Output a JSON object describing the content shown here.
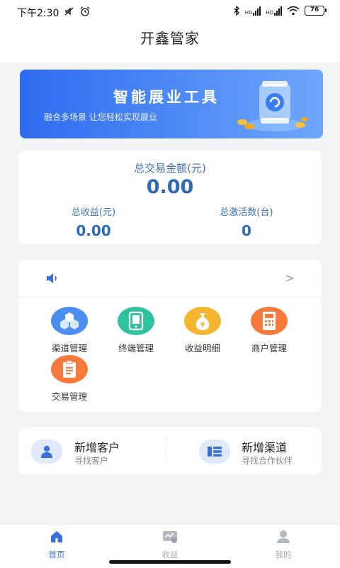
{
  "status_bar": {
    "time": "下午2:30",
    "signal1_label": "HD",
    "signal2_label": "HD",
    "battery": "76"
  },
  "header": {
    "title": "开鑫管家"
  },
  "banner": {
    "title": "智能展业工具",
    "subtitle": "融合多场景  让您轻松实现展业"
  },
  "stats": {
    "total_amount_label": "总交易金额(元)",
    "total_amount_value": "0.00",
    "total_income_label": "总收益(元)",
    "total_income_value": "0.00",
    "total_activations_label": "总激活数(台)",
    "total_activations_value": "0"
  },
  "notice": {
    "text": ""
  },
  "menu": [
    {
      "label": "渠道管理",
      "icon": "channel-icon",
      "color": "#4a8ef0"
    },
    {
      "label": "终端管理",
      "icon": "terminal-icon",
      "color": "#2fc3a0"
    },
    {
      "label": "收益明细",
      "icon": "income-bag-icon",
      "color": "#f6b52f"
    },
    {
      "label": "商户管理",
      "icon": "merchant-icon",
      "color": "#f57a3c"
    },
    {
      "label": "交易管理",
      "icon": "transaction-icon",
      "color": "#f57a3c"
    }
  ],
  "quick_actions": [
    {
      "title": "新增客户",
      "subtitle": "寻找客户",
      "icon": "user-add-icon"
    },
    {
      "title": "新增渠道",
      "subtitle": "寻找合作伙伴",
      "icon": "channel-list-icon"
    }
  ],
  "bottom_nav": [
    {
      "label": "首页",
      "icon": "home-icon",
      "active": true
    },
    {
      "label": "收益",
      "icon": "income-icon",
      "active": false
    },
    {
      "label": "我的",
      "icon": "profile-icon",
      "active": false
    }
  ],
  "colors": {
    "accent": "#3a6fd8",
    "banner_start": "#2f6bf0",
    "value_text": "#2f6ab3"
  }
}
